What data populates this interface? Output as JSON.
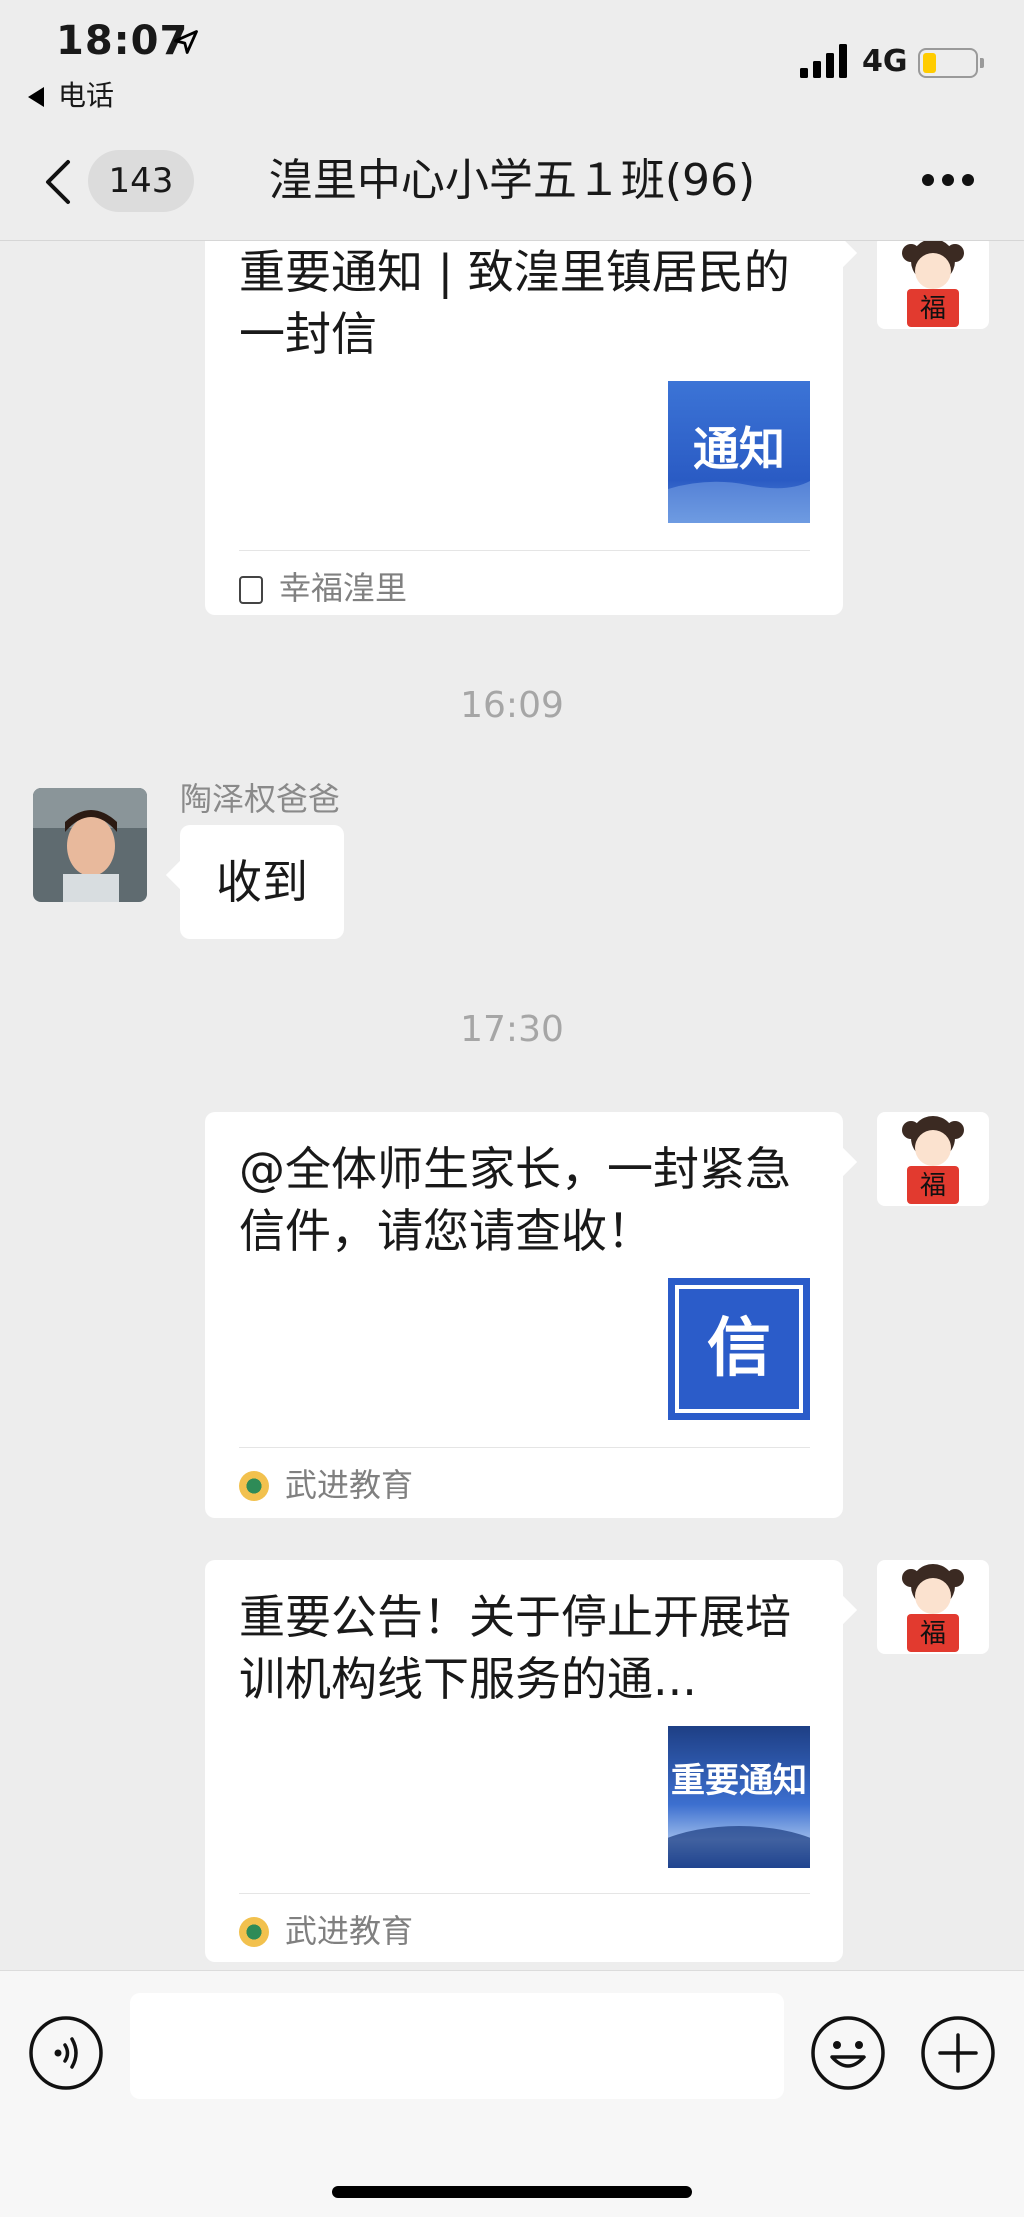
{
  "status_bar": {
    "time": "18:07",
    "back_app": "电话",
    "network": "4G",
    "battery_level": 0.2
  },
  "nav": {
    "unread_count": "143",
    "title": "湟里中心小学五１班(96)"
  },
  "messages": [
    {
      "title": "重要通知 | 致湟里镇居民的一封信",
      "thumb_text": "通知",
      "source": "幸福湟里"
    },
    {
      "time": "16:09"
    },
    {
      "sender": "陶泽权爸爸",
      "text": "收到"
    },
    {
      "time": "17:30"
    },
    {
      "title": "@全体师生家长，一封紧急信件，请您请查收！",
      "thumb_text": "信",
      "source": "武进教育"
    },
    {
      "title": "重要公告！关于停止开展培训机构线下服务的通...",
      "thumb_text": "重要通知",
      "source": "武进教育"
    }
  ],
  "colors": {
    "background": "#ededed",
    "bubble": "#ffffff",
    "accent_blue": "#2b5cc9"
  },
  "icons": [
    "location-arrow-icon",
    "signal-icon",
    "chevron-left-icon",
    "more-icon",
    "voice-icon",
    "emoji-icon",
    "plus-icon"
  ]
}
